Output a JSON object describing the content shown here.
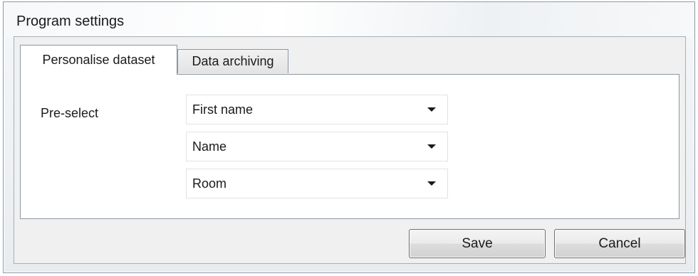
{
  "window": {
    "title": "Program settings"
  },
  "tabs": [
    {
      "label": "Personalise dataset",
      "active": true
    },
    {
      "label": "Data archiving",
      "active": false
    }
  ],
  "preselect": {
    "label": "Pre-select",
    "combos": [
      {
        "value": "First name"
      },
      {
        "value": "Name"
      },
      {
        "value": "Room"
      }
    ]
  },
  "buttons": {
    "save_label": "Save",
    "cancel_label": "Cancel"
  },
  "icons": {
    "dropdown": "chevron-down-icon"
  }
}
